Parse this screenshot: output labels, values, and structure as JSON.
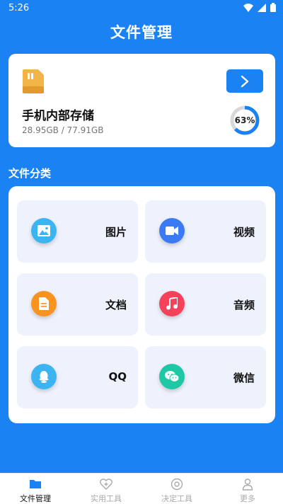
{
  "status_bar": {
    "time": "5:26"
  },
  "header": {
    "title": "文件管理"
  },
  "storage": {
    "name": "手机内部存储",
    "size": "28.95GB / 77.91GB",
    "percent_label": "63%",
    "percent": 63
  },
  "categories": {
    "title": "文件分类",
    "items": [
      {
        "label": "图片",
        "icon": "image-icon",
        "color": "#3db4f2"
      },
      {
        "label": "视频",
        "icon": "video-camera-icon",
        "color": "#3a7bf5"
      },
      {
        "label": "文档",
        "icon": "document-icon",
        "color": "#f7931e"
      },
      {
        "label": "音频",
        "icon": "music-note-icon",
        "color": "#f5425a"
      },
      {
        "label": "QQ",
        "icon": "qq-penguin-icon",
        "color": "#3db4f2"
      },
      {
        "label": "微信",
        "icon": "wechat-icon",
        "color": "#1fc8a4"
      }
    ]
  },
  "bottom_nav": {
    "items": [
      {
        "label": "文件管理",
        "icon": "folder-icon",
        "active": true
      },
      {
        "label": "实用工具",
        "icon": "heart-plus-icon",
        "active": false
      },
      {
        "label": "决定工具",
        "icon": "target-icon",
        "active": false
      },
      {
        "label": "更多",
        "icon": "user-icon",
        "active": false
      }
    ]
  },
  "colors": {
    "primary": "#1a82f2",
    "card": "#ffffff",
    "tile": "#eef2fc"
  }
}
